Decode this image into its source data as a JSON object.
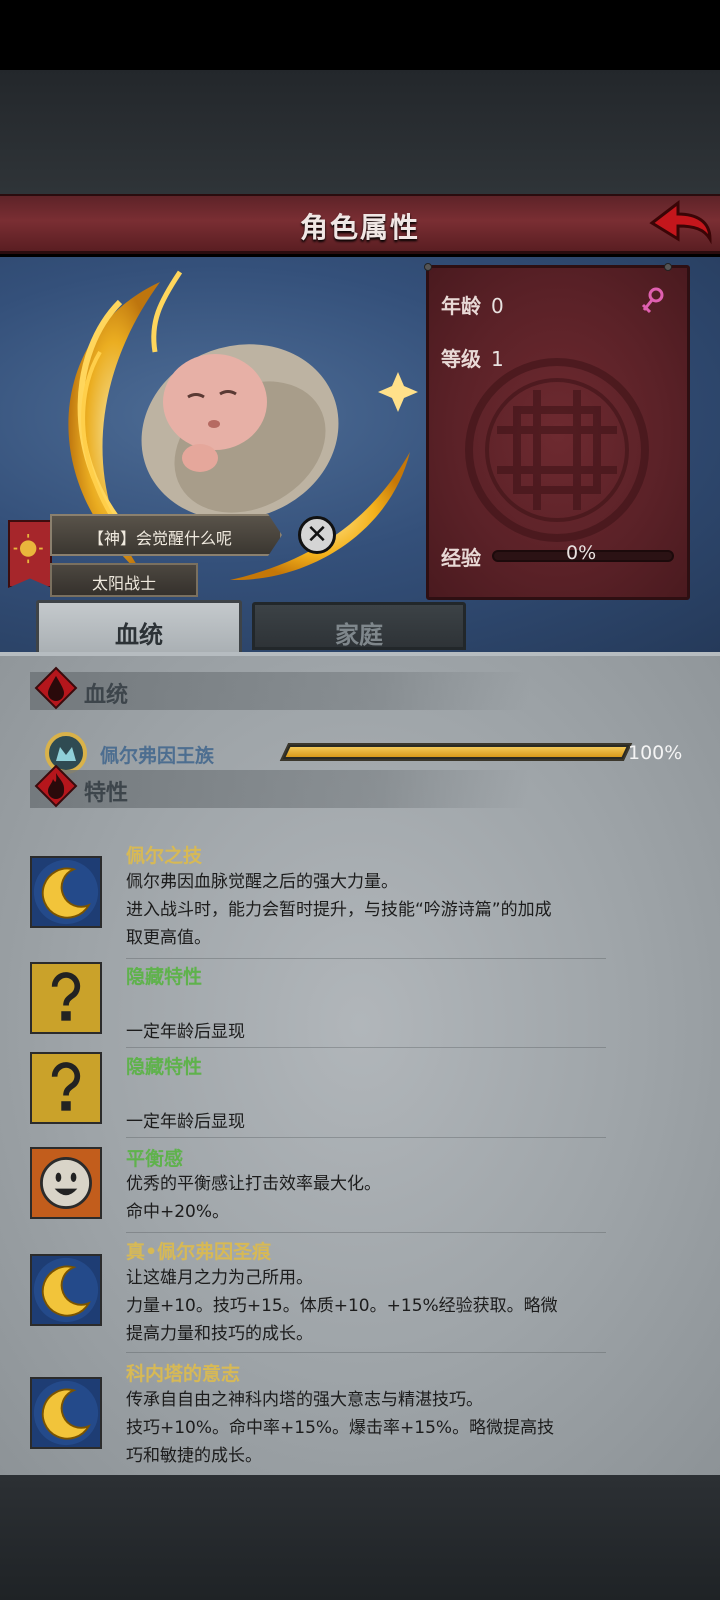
{
  "header": {
    "title": "角色属性"
  },
  "icons": {
    "back": "back-arrow-icon",
    "gender": "female-icon",
    "close": "close-icon"
  },
  "stats": {
    "age_label": "年龄",
    "age_value": "0",
    "level_label": "等级",
    "level_value": "1",
    "exp_label": "经验",
    "exp_value": "0%",
    "exp_fraction": 0
  },
  "character": {
    "title": "【神】会觉醒什么呢",
    "class": "太阳战士"
  },
  "tabs": [
    {
      "label": "血统",
      "active": true
    },
    {
      "label": "家庭",
      "active": false
    }
  ],
  "lineage": {
    "section_title": "血统",
    "name": "佩尔弗因王族",
    "percent": "100%",
    "fraction": 1.0
  },
  "traits_section": {
    "title": "特性"
  },
  "traits": [
    {
      "icon": "crescent-moon-icon",
      "name": "佩尔之技",
      "color": "#d7b955",
      "lines": [
        "佩尔弗因血脉觉醒之后的强大力量。",
        "进入战斗时，能力会暂时提升，与技能“吟游诗篇”的加成",
        "取更高值。"
      ]
    },
    {
      "icon": "question-mark-icon",
      "name": "隐藏特性",
      "color": "#5fb24c",
      "lines": [
        "",
        "一定年龄后显现"
      ]
    },
    {
      "icon": "question-mark-icon",
      "name": "隐藏特性",
      "color": "#5fb24c",
      "lines": [
        "",
        "一定年龄后显现"
      ]
    },
    {
      "icon": "smiley-face-icon",
      "name": "平衡感",
      "color": "#5fb24c",
      "lines": [
        "优秀的平衡感让打击效率最大化。",
        "命中+20%。"
      ]
    },
    {
      "icon": "crescent-moon-icon",
      "name": "真•佩尔弗因圣痕",
      "color": "#d7b955",
      "lines": [
        "让这雄月之力为己所用。",
        "力量+10。技巧+15。体质+10。+15%经验获取。略微",
        "提高力量和技巧的成长。"
      ]
    },
    {
      "icon": "crescent-moon-icon",
      "name": "科内塔的意志",
      "color": "#d7b955",
      "lines": [
        "传承自自由之神科内塔的强大意志与精湛技巧。",
        "技巧+10%。命中率+15%。爆击率+15%。略微提高技",
        "巧和敏捷的成长。"
      ]
    }
  ]
}
